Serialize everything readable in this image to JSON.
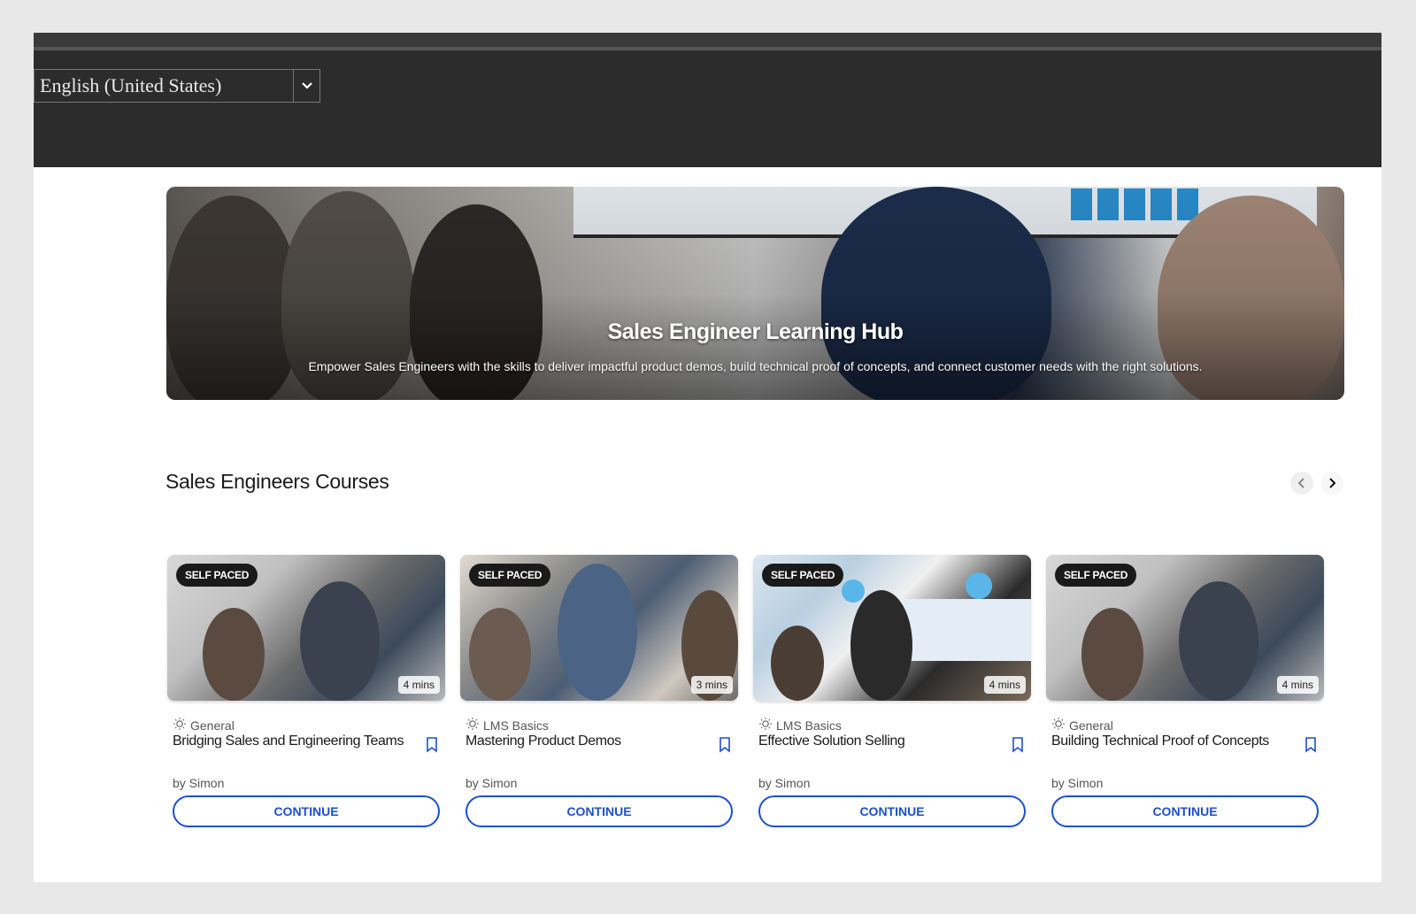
{
  "language": {
    "selected": "English (United States)"
  },
  "hero": {
    "title": "Sales Engineer Learning Hub",
    "subtitle": "Empower Sales Engineers with the skills to deliver impactful product demos, build technical proof of concepts, and connect customer needs with the right solutions."
  },
  "section": {
    "title": "Sales Engineers Courses"
  },
  "colors": {
    "accent": "#1b4fd1",
    "topbar": "#2c2c2c"
  },
  "courses": [
    {
      "badge": "SELF PACED",
      "duration": "4 mins",
      "category": "General",
      "title": "Bridging Sales and Engineering Teams",
      "author": "by Simon",
      "action": "CONTINUE"
    },
    {
      "badge": "SELF PACED",
      "duration": "3 mins",
      "category": "LMS Basics",
      "title": "Mastering Product Demos",
      "author": "by Simon",
      "action": "CONTINUE"
    },
    {
      "badge": "SELF PACED",
      "duration": "4 mins",
      "category": "LMS Basics",
      "title": "Effective Solution Selling",
      "author": "by Simon",
      "action": "CONTINUE"
    },
    {
      "badge": "SELF PACED",
      "duration": "4 mins",
      "category": "General",
      "title": "Building Technical Proof of Concepts",
      "author": "by Simon",
      "action": "CONTINUE"
    }
  ]
}
